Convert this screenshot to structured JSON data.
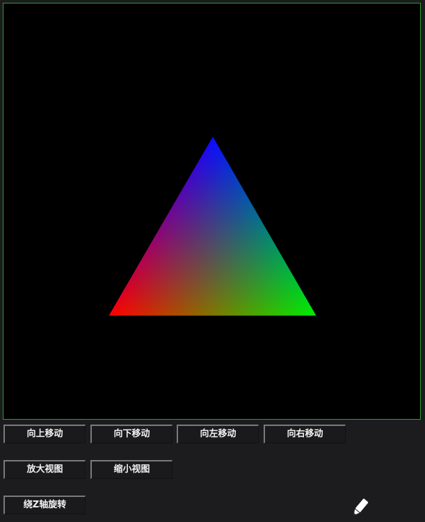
{
  "canvas": {
    "background": "#000000",
    "border_color": "#2f9e2f",
    "triangle": {
      "vertex_colors": [
        "#0a0aff",
        "#ff0000",
        "#00ee00"
      ]
    }
  },
  "controls": {
    "move_up_label": "向上移动",
    "move_down_label": "向下移动",
    "move_left_label": "向左移动",
    "move_right_label": "向右移动",
    "zoom_in_label": "放大视图",
    "zoom_out_label": "缩小视图",
    "rotate_z_label": "绕Z轴旋转"
  },
  "cursor": {
    "icon": "pen-cursor-icon"
  }
}
